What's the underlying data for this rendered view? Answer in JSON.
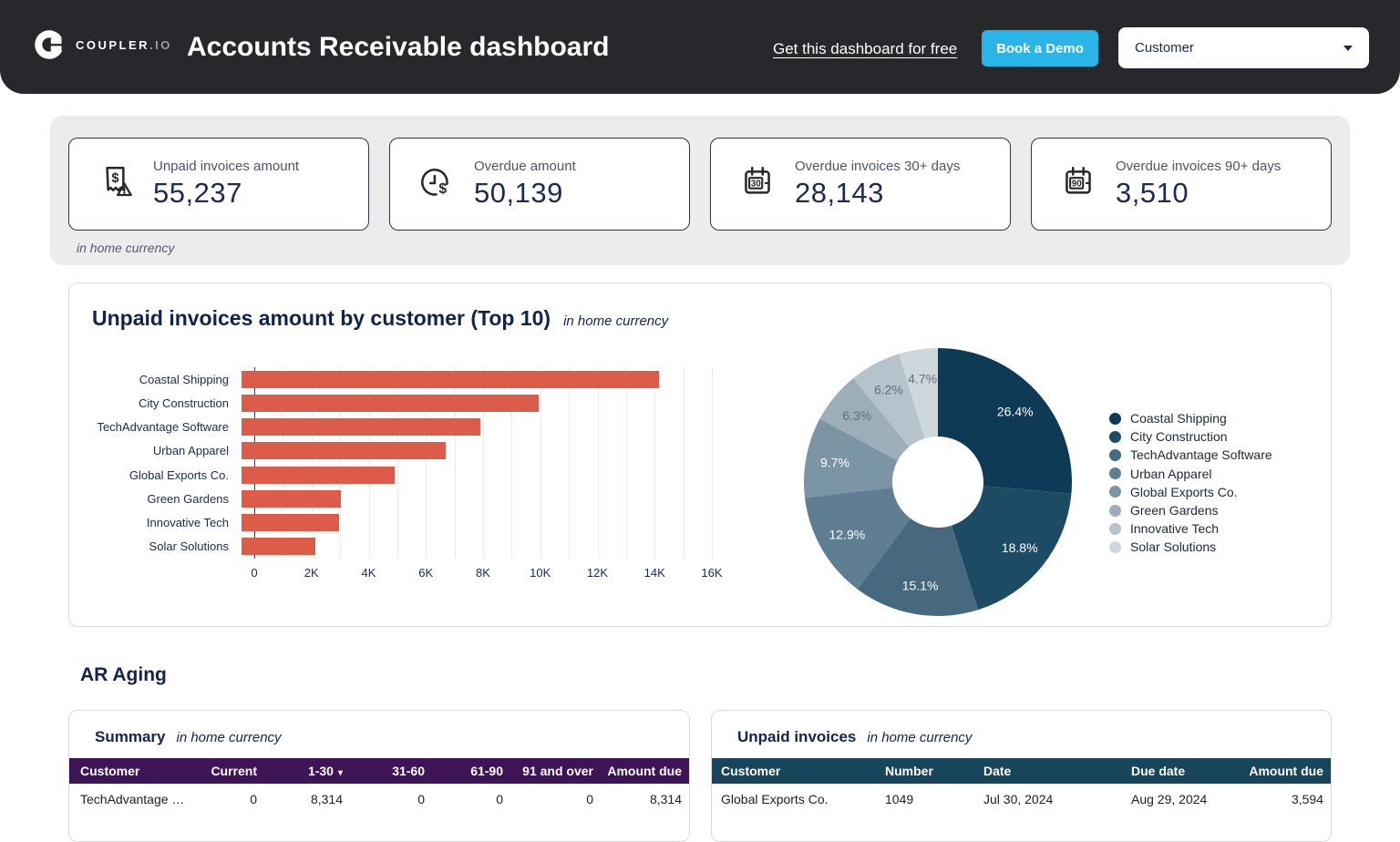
{
  "header": {
    "brand": "COUPLER",
    "brand_suffix": ".IO",
    "title": "Accounts Receivable dashboard",
    "link_label": "Get this dashboard for free",
    "demo_button_label": "Book a Demo",
    "demo_button_color": "#2AB5E8",
    "filter_selected_value": "Customer"
  },
  "kpis": {
    "caption": "in home currency",
    "cards": [
      {
        "icon": "invoice-alert-icon",
        "label": "Unpaid invoices amount",
        "value": "55,237"
      },
      {
        "icon": "clock-dollar-icon",
        "label": "Overdue amount",
        "value": "50,139"
      },
      {
        "icon": "calendar-30-icon",
        "icon_text": "30",
        "label": "Overdue invoices 30+ days",
        "value": "28,143"
      },
      {
        "icon": "calendar-90-icon",
        "icon_text": "90",
        "label": "Overdue invoices 90+ days",
        "value": "3,510"
      }
    ]
  },
  "chart_card": {
    "title": "Unpaid invoices amount by customer (Top 10)",
    "subtitle": "in home currency"
  },
  "chart_data": [
    {
      "type": "bar",
      "orientation": "horizontal",
      "title": "Unpaid invoices amount by customer (Top 10)",
      "categories": [
        "Coastal Shipping",
        "City Construction",
        "TechAdvantage Software",
        "Urban Apparel",
        "Global Exports Co.",
        "Green Gardens",
        "Innovative Tech",
        "Solar Solutions"
      ],
      "values": [
        14583,
        10385,
        8341,
        7126,
        5358,
        3480,
        3425,
        2596
      ],
      "xlim": [
        0,
        16000
      ],
      "xticks": [
        "0",
        "2K",
        "4K",
        "6K",
        "8K",
        "10K",
        "12K",
        "14K",
        "16K"
      ],
      "tick_step": 2000,
      "gridline_step": 1000,
      "grid": true,
      "bar_color": "#DC5B49"
    },
    {
      "type": "pie",
      "donut": true,
      "labels": [
        "Coastal Shipping",
        "City Construction",
        "TechAdvantage Software",
        "Urban Apparel",
        "Global Exports Co.",
        "Green Gardens",
        "Innovative Tech",
        "Solar Solutions"
      ],
      "percents": [
        26.4,
        18.8,
        15.1,
        12.9,
        9.7,
        6.3,
        6.2,
        4.7
      ],
      "colors": [
        "#0E3A55",
        "#1D4B63",
        "#46697F",
        "#5F7E92",
        "#7B95A4",
        "#9BAEBA",
        "#B5C3CC",
        "#CDD7DC"
      ],
      "label_colors": [
        "#FFFFFF",
        "#FFFFFF",
        "#FFFFFF",
        "#FFFFFF",
        "#FFFFFF",
        "#5E7080",
        "#5E7080",
        "#5E7080"
      ],
      "legend_position": "right"
    }
  ],
  "ar_aging": {
    "heading": "AR Aging",
    "summary": {
      "title": "Summary",
      "subtitle": "in home currency",
      "header_bg": "#3F1456",
      "columns": [
        "Customer",
        "Current",
        "1-30",
        "31-60",
        "61-90",
        "91 and over",
        "Amount due"
      ],
      "sorted_column_index": 2,
      "sort_indicator": "▾",
      "rows": [
        [
          "TechAdvantage …",
          "0",
          "8,314",
          "0",
          "0",
          "0",
          "8,314"
        ]
      ]
    },
    "unpaid": {
      "title": "Unpaid invoices",
      "subtitle": "in home currency",
      "header_bg": "#17455C",
      "columns": [
        "Customer",
        "Number",
        "Date",
        "Due date",
        "Amount due"
      ],
      "rows": [
        [
          "Global Exports Co.",
          "1049",
          "Jul 30, 2024",
          "Aug 29, 2024",
          "3,594"
        ]
      ]
    }
  }
}
